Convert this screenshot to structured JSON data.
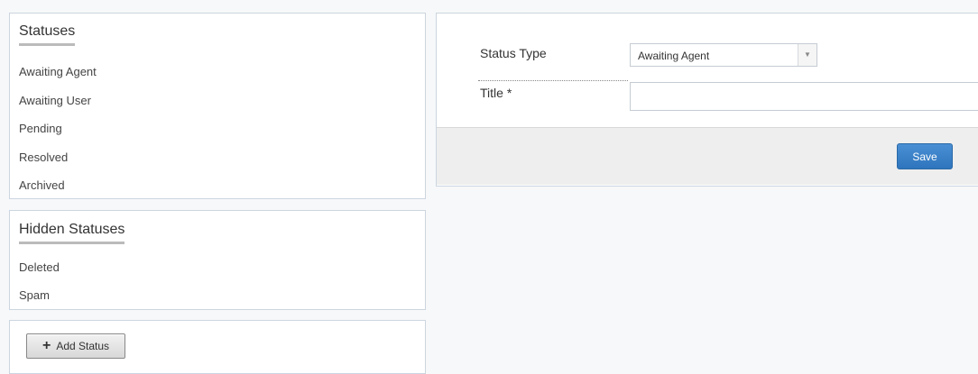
{
  "statuses_panel": {
    "title": "Statuses",
    "items": [
      "Awaiting Agent",
      "Awaiting User",
      "Pending",
      "Resolved",
      "Archived"
    ]
  },
  "hidden_panel": {
    "title": "Hidden Statuses",
    "items": [
      "Deleted",
      "Spam"
    ]
  },
  "add_panel": {
    "add_button_label": "Add Status"
  },
  "form": {
    "status_type_label": "Status Type",
    "status_type_value": "Awaiting Agent",
    "title_label": "Title *",
    "title_value": "",
    "save_label": "Save"
  }
}
